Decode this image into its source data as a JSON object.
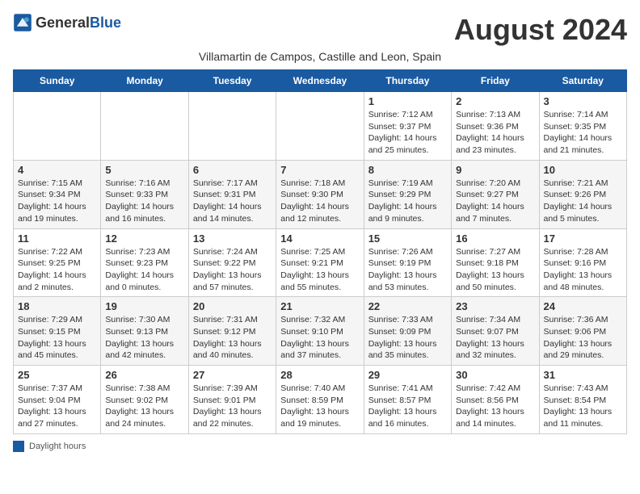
{
  "header": {
    "logo_general": "General",
    "logo_blue": "Blue",
    "month_title": "August 2024",
    "subtitle": "Villamartin de Campos, Castille and Leon, Spain"
  },
  "weekdays": [
    "Sunday",
    "Monday",
    "Tuesday",
    "Wednesday",
    "Thursday",
    "Friday",
    "Saturday"
  ],
  "legend_label": "Daylight hours",
  "weeks": [
    [
      {
        "day": "",
        "info": ""
      },
      {
        "day": "",
        "info": ""
      },
      {
        "day": "",
        "info": ""
      },
      {
        "day": "",
        "info": ""
      },
      {
        "day": "1",
        "info": "Sunrise: 7:12 AM\nSunset: 9:37 PM\nDaylight: 14 hours and 25 minutes."
      },
      {
        "day": "2",
        "info": "Sunrise: 7:13 AM\nSunset: 9:36 PM\nDaylight: 14 hours and 23 minutes."
      },
      {
        "day": "3",
        "info": "Sunrise: 7:14 AM\nSunset: 9:35 PM\nDaylight: 14 hours and 21 minutes."
      }
    ],
    [
      {
        "day": "4",
        "info": "Sunrise: 7:15 AM\nSunset: 9:34 PM\nDaylight: 14 hours and 19 minutes."
      },
      {
        "day": "5",
        "info": "Sunrise: 7:16 AM\nSunset: 9:33 PM\nDaylight: 14 hours and 16 minutes."
      },
      {
        "day": "6",
        "info": "Sunrise: 7:17 AM\nSunset: 9:31 PM\nDaylight: 14 hours and 14 minutes."
      },
      {
        "day": "7",
        "info": "Sunrise: 7:18 AM\nSunset: 9:30 PM\nDaylight: 14 hours and 12 minutes."
      },
      {
        "day": "8",
        "info": "Sunrise: 7:19 AM\nSunset: 9:29 PM\nDaylight: 14 hours and 9 minutes."
      },
      {
        "day": "9",
        "info": "Sunrise: 7:20 AM\nSunset: 9:27 PM\nDaylight: 14 hours and 7 minutes."
      },
      {
        "day": "10",
        "info": "Sunrise: 7:21 AM\nSunset: 9:26 PM\nDaylight: 14 hours and 5 minutes."
      }
    ],
    [
      {
        "day": "11",
        "info": "Sunrise: 7:22 AM\nSunset: 9:25 PM\nDaylight: 14 hours and 2 minutes."
      },
      {
        "day": "12",
        "info": "Sunrise: 7:23 AM\nSunset: 9:23 PM\nDaylight: 14 hours and 0 minutes."
      },
      {
        "day": "13",
        "info": "Sunrise: 7:24 AM\nSunset: 9:22 PM\nDaylight: 13 hours and 57 minutes."
      },
      {
        "day": "14",
        "info": "Sunrise: 7:25 AM\nSunset: 9:21 PM\nDaylight: 13 hours and 55 minutes."
      },
      {
        "day": "15",
        "info": "Sunrise: 7:26 AM\nSunset: 9:19 PM\nDaylight: 13 hours and 53 minutes."
      },
      {
        "day": "16",
        "info": "Sunrise: 7:27 AM\nSunset: 9:18 PM\nDaylight: 13 hours and 50 minutes."
      },
      {
        "day": "17",
        "info": "Sunrise: 7:28 AM\nSunset: 9:16 PM\nDaylight: 13 hours and 48 minutes."
      }
    ],
    [
      {
        "day": "18",
        "info": "Sunrise: 7:29 AM\nSunset: 9:15 PM\nDaylight: 13 hours and 45 minutes."
      },
      {
        "day": "19",
        "info": "Sunrise: 7:30 AM\nSunset: 9:13 PM\nDaylight: 13 hours and 42 minutes."
      },
      {
        "day": "20",
        "info": "Sunrise: 7:31 AM\nSunset: 9:12 PM\nDaylight: 13 hours and 40 minutes."
      },
      {
        "day": "21",
        "info": "Sunrise: 7:32 AM\nSunset: 9:10 PM\nDaylight: 13 hours and 37 minutes."
      },
      {
        "day": "22",
        "info": "Sunrise: 7:33 AM\nSunset: 9:09 PM\nDaylight: 13 hours and 35 minutes."
      },
      {
        "day": "23",
        "info": "Sunrise: 7:34 AM\nSunset: 9:07 PM\nDaylight: 13 hours and 32 minutes."
      },
      {
        "day": "24",
        "info": "Sunrise: 7:36 AM\nSunset: 9:06 PM\nDaylight: 13 hours and 29 minutes."
      }
    ],
    [
      {
        "day": "25",
        "info": "Sunrise: 7:37 AM\nSunset: 9:04 PM\nDaylight: 13 hours and 27 minutes."
      },
      {
        "day": "26",
        "info": "Sunrise: 7:38 AM\nSunset: 9:02 PM\nDaylight: 13 hours and 24 minutes."
      },
      {
        "day": "27",
        "info": "Sunrise: 7:39 AM\nSunset: 9:01 PM\nDaylight: 13 hours and 22 minutes."
      },
      {
        "day": "28",
        "info": "Sunrise: 7:40 AM\nSunset: 8:59 PM\nDaylight: 13 hours and 19 minutes."
      },
      {
        "day": "29",
        "info": "Sunrise: 7:41 AM\nSunset: 8:57 PM\nDaylight: 13 hours and 16 minutes."
      },
      {
        "day": "30",
        "info": "Sunrise: 7:42 AM\nSunset: 8:56 PM\nDaylight: 13 hours and 14 minutes."
      },
      {
        "day": "31",
        "info": "Sunrise: 7:43 AM\nSunset: 8:54 PM\nDaylight: 13 hours and 11 minutes."
      }
    ]
  ]
}
